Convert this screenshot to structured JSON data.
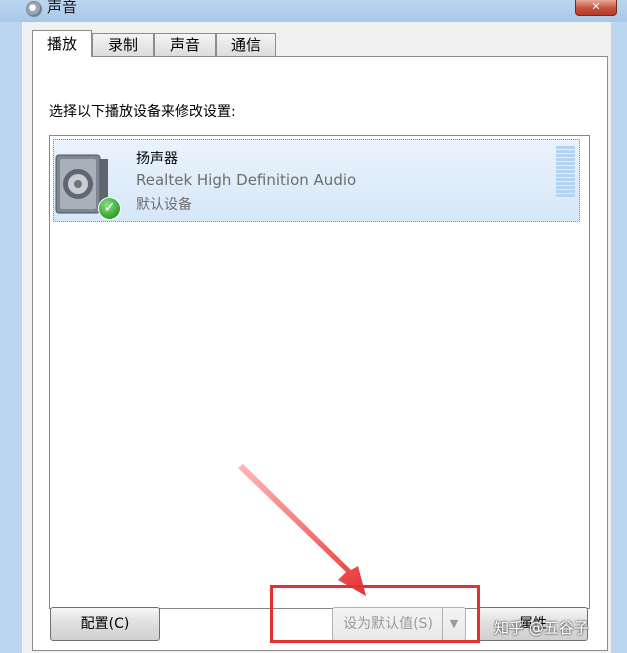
{
  "window": {
    "title": "声音",
    "close_glyph": "✕"
  },
  "tabs": [
    {
      "label": "播放",
      "active": true
    },
    {
      "label": "录制",
      "active": false
    },
    {
      "label": "声音",
      "active": false
    },
    {
      "label": "通信",
      "active": false
    }
  ],
  "playback": {
    "instruction": "选择以下播放设备来修改设置:",
    "devices": [
      {
        "name": "扬声器",
        "description": "Realtek High Definition Audio",
        "status": "默认设备",
        "icon": "speaker-icon",
        "badge_icon": "check-icon",
        "badge_glyph": "✓"
      }
    ]
  },
  "buttons": {
    "configure": "配置(C)",
    "set_default": "设为默认值(S)",
    "set_default_arrow": "▼",
    "properties": "属性"
  },
  "watermark": "知乎 @五谷子",
  "colors": {
    "annotation_red": "#e53030",
    "selection": "#d6e7f8"
  }
}
